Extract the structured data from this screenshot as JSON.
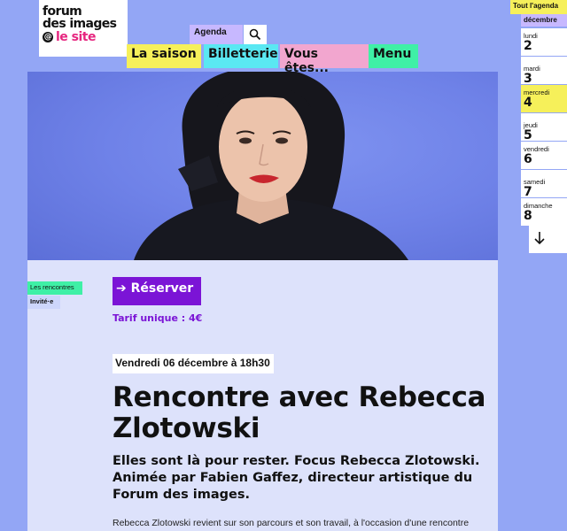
{
  "logo": {
    "line1": "forum",
    "line2": "des images",
    "line3": "le site"
  },
  "nav": {
    "agenda": "Agenda",
    "items": [
      "La saison",
      "Billetterie",
      "Vous êtes...",
      "Menu"
    ]
  },
  "calendar": {
    "all_label": "Tout l'agenda",
    "month": "décembre",
    "days": [
      {
        "name": "lundi",
        "num": "2"
      },
      {
        "name": "mardi",
        "num": "3"
      },
      {
        "name": "mercredi",
        "num": "4"
      },
      {
        "name": "jeudi",
        "num": "5"
      },
      {
        "name": "vendredi",
        "num": "6"
      },
      {
        "name": "samedi",
        "num": "7"
      },
      {
        "name": "dimanche",
        "num": "8"
      }
    ]
  },
  "event": {
    "tag_category": "Les rencontres",
    "tag_guest": "Invité·e",
    "reserve": "➔ Réserver",
    "tarif": "Tarif unique : 4€",
    "date": "Vendredi 06 décembre à 18h30",
    "title": "Rencontre avec Rebecca Zlotowski",
    "subtitle": "Elles sont là pour rester. Focus Rebecca Zlotowski. Animée par Fabien Gaffez, directeur artistique du Forum des images.",
    "body": "Rebecca Zlotowski revient sur son parcours et son travail, à l'occasion d'une rencontre"
  },
  "colors": {
    "background": "#93a6f5",
    "yellow": "#f6f05a",
    "cyan": "#5ae8f2",
    "pink": "#f2a6cf",
    "green": "#3ff0a6",
    "lavender": "#c7b8ff",
    "purple": "#7b14d6",
    "logo_pink": "#e6257f"
  }
}
